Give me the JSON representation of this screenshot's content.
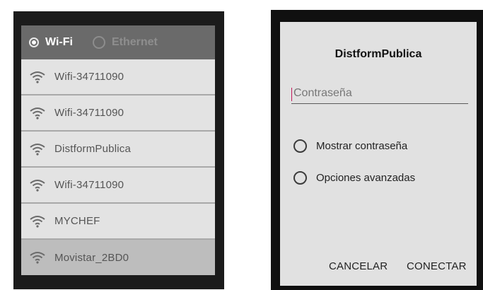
{
  "network_panel": {
    "tabs": [
      {
        "label": "Wi-Fi",
        "selected": true
      },
      {
        "label": "Ethernet",
        "selected": false
      }
    ],
    "networks": [
      {
        "name": "Wifi-34711090",
        "icon": "wifi-icon"
      },
      {
        "name": "Wifi-34711090",
        "icon": "wifi-icon"
      },
      {
        "name": "DistformPublica",
        "icon": "wifi-icon"
      },
      {
        "name": "Wifi-34711090",
        "icon": "wifi-icon"
      },
      {
        "name": "MYCHEF",
        "icon": "wifi-icon"
      },
      {
        "name": "Movistar_2BD0",
        "icon": "wifi-icon",
        "highlighted": true
      }
    ]
  },
  "dialog": {
    "title": "DistformPublica",
    "password": {
      "placeholder": "Contraseña",
      "value": ""
    },
    "options": [
      {
        "label": "Mostrar contraseña",
        "checked": false
      },
      {
        "label": "Opciones avanzadas",
        "checked": false
      }
    ],
    "buttons": {
      "cancel": "CANCELAR",
      "connect": "CONECTAR"
    }
  },
  "colors": {
    "panel_bg": "#1b1b1b",
    "tab_bar": "#6a6a6a",
    "list_item": "#e3e3e3",
    "list_item_highlight": "#bdbdbd",
    "dialog_bg": "#e1e1e1",
    "cursor_accent": "#c2185b"
  }
}
